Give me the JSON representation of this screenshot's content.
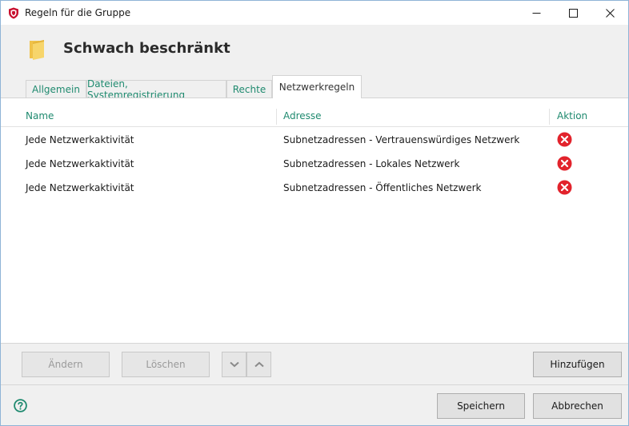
{
  "window": {
    "title": "Regeln für die Gruppe",
    "icon": "shield-icon",
    "controls": [
      "minimize-icon",
      "maximize-icon",
      "close-icon"
    ]
  },
  "header": {
    "icon": "folder-icon",
    "title": "Schwach beschränkt"
  },
  "tabs": [
    {
      "label": "Allgemein",
      "active": false
    },
    {
      "label": "Dateien, Systemregistrierung",
      "active": false
    },
    {
      "label": "Rechte",
      "active": false
    },
    {
      "label": "Netzwerkregeln",
      "active": true
    }
  ],
  "table": {
    "columns": [
      "Name",
      "Adresse",
      "Aktion"
    ],
    "rows": [
      {
        "name": "Jede Netzwerkaktivität",
        "address": "Subnetzadressen - Vertrauenswürdiges Netzwerk",
        "action_icon": "deny-icon"
      },
      {
        "name": "Jede Netzwerkaktivität",
        "address": "Subnetzadressen - Lokales Netzwerk",
        "action_icon": "deny-icon"
      },
      {
        "name": "Jede Netzwerkaktivität",
        "address": "Subnetzadressen - Öffentliches Netzwerk",
        "action_icon": "deny-icon"
      }
    ]
  },
  "toolbar": {
    "edit_label": "Ändern",
    "delete_label": "Löschen",
    "move_down_icon": "chevron-down-icon",
    "move_up_icon": "chevron-up-icon",
    "add_label": "Hinzufügen"
  },
  "footer": {
    "help_icon": "help-icon",
    "save_label": "Speichern",
    "cancel_label": "Abbrechen"
  },
  "colors": {
    "accent": "#1f8a6f",
    "deny": "#e2232c",
    "brand": "#c8102e"
  }
}
